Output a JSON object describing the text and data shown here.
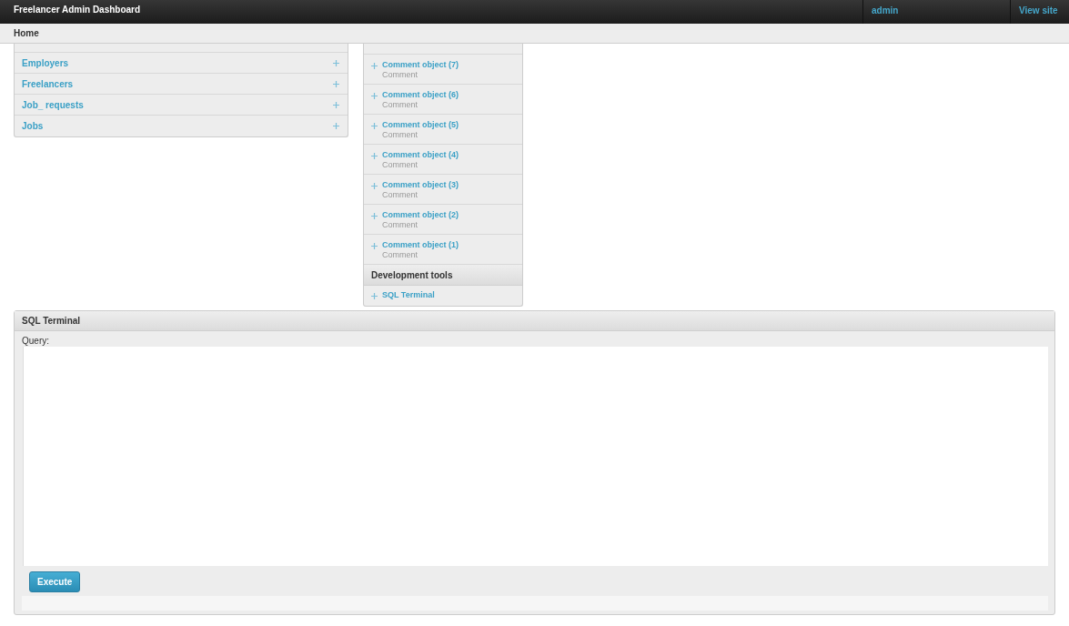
{
  "header": {
    "title": "Freelancer Admin Dashboard",
    "links": [
      {
        "label": "admin"
      },
      {
        "label": "View site"
      }
    ]
  },
  "breadcrumbs": [
    "Home"
  ],
  "left_panel": {
    "items": [
      {
        "label": "Employers"
      },
      {
        "label": "Freelancers"
      },
      {
        "label": "Job_ requests"
      },
      {
        "label": "Jobs"
      }
    ]
  },
  "middle_panel": {
    "items": [
      {
        "label": "Comment object (7)",
        "subtitle": "Comment"
      },
      {
        "label": "Comment object (6)",
        "subtitle": "Comment"
      },
      {
        "label": "Comment object (5)",
        "subtitle": "Comment"
      },
      {
        "label": "Comment object (4)",
        "subtitle": "Comment"
      },
      {
        "label": "Comment object (3)",
        "subtitle": "Comment"
      },
      {
        "label": "Comment object (2)",
        "subtitle": "Comment"
      },
      {
        "label": "Comment object (1)",
        "subtitle": "Comment"
      }
    ],
    "sections": [
      {
        "title": "Development tools",
        "items": [
          {
            "label": "SQL Terminal"
          }
        ]
      }
    ]
  },
  "sql_terminal": {
    "title": "SQL Terminal",
    "query_label": "Query:",
    "button": "Execute"
  }
}
